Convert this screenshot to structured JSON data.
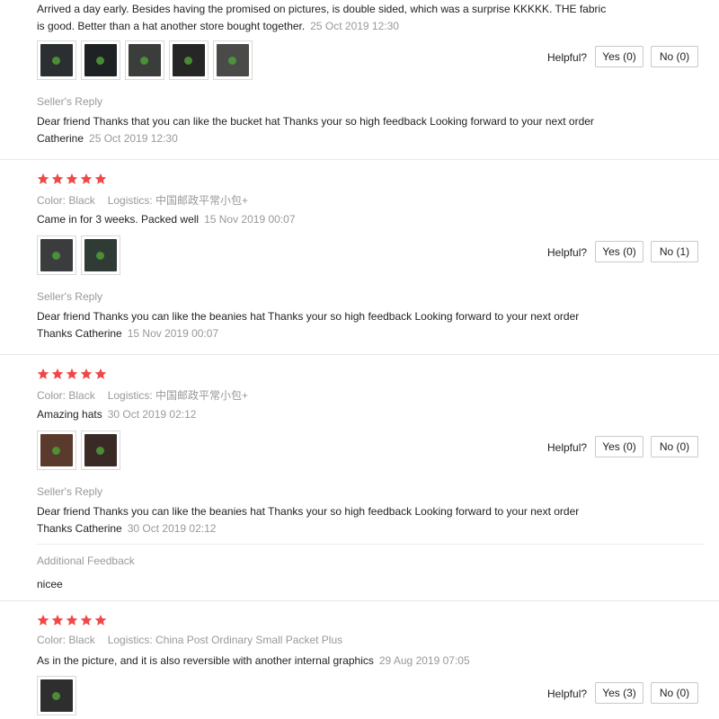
{
  "common": {
    "helpful_label": "Helpful?",
    "seller_reply_label": "Seller's Reply",
    "additional_feedback_label": "Additional Feedback",
    "star_color": "#f04848",
    "muted_color": "#999999"
  },
  "reviews": [
    {
      "text": "Arrived a day early. Besides having the promised on pictures, is double sided, which was a surprise KKKKK. THE fabric is good. Better than a hat another store bought together.",
      "date": "25 Oct 2019 12:30",
      "photo_count": 5,
      "yes_label": "Yes (0)",
      "no_label": "No (0)",
      "reply_text": "Dear friend Thanks that you can like the bucket hat Thanks your so high feedback Looking forward to your next order Catherine",
      "reply_date": "25 Oct 2019 12:30"
    },
    {
      "rating": 5,
      "color_label": "Color: Black",
      "logistics_label": "Logistics: 中国邮政平常小包+",
      "text": "Came in for 3 weeks. Packed well",
      "date": "15 Nov 2019 00:07",
      "photo_count": 2,
      "yes_label": "Yes (0)",
      "no_label": "No (1)",
      "reply_text": "Dear friend Thanks you can like the beanies hat Thanks your so high feedback Looking forward to your next order Thanks Catherine",
      "reply_date": "15 Nov 2019 00:07"
    },
    {
      "rating": 5,
      "color_label": "Color: Black",
      "logistics_label": "Logistics: 中国邮政平常小包+",
      "text": "Amazing hats",
      "date": "30 Oct 2019 02:12",
      "photo_count": 2,
      "yes_label": "Yes (0)",
      "no_label": "No (0)",
      "reply_text": "Dear friend Thanks you can like the beanies hat Thanks your so high feedback Looking forward to your next order Thanks Catherine",
      "reply_date": "30 Oct 2019 02:12",
      "additional_text": "nicee"
    },
    {
      "rating": 5,
      "color_label": "Color: Black",
      "logistics_label": "Logistics: China Post Ordinary Small Packet Plus",
      "text": "As in the picture, and it is also reversible with another internal graphics",
      "date": "29 Aug 2019 07:05",
      "photo_count": 1,
      "yes_label": "Yes (3)",
      "no_label": "No (0)"
    }
  ]
}
